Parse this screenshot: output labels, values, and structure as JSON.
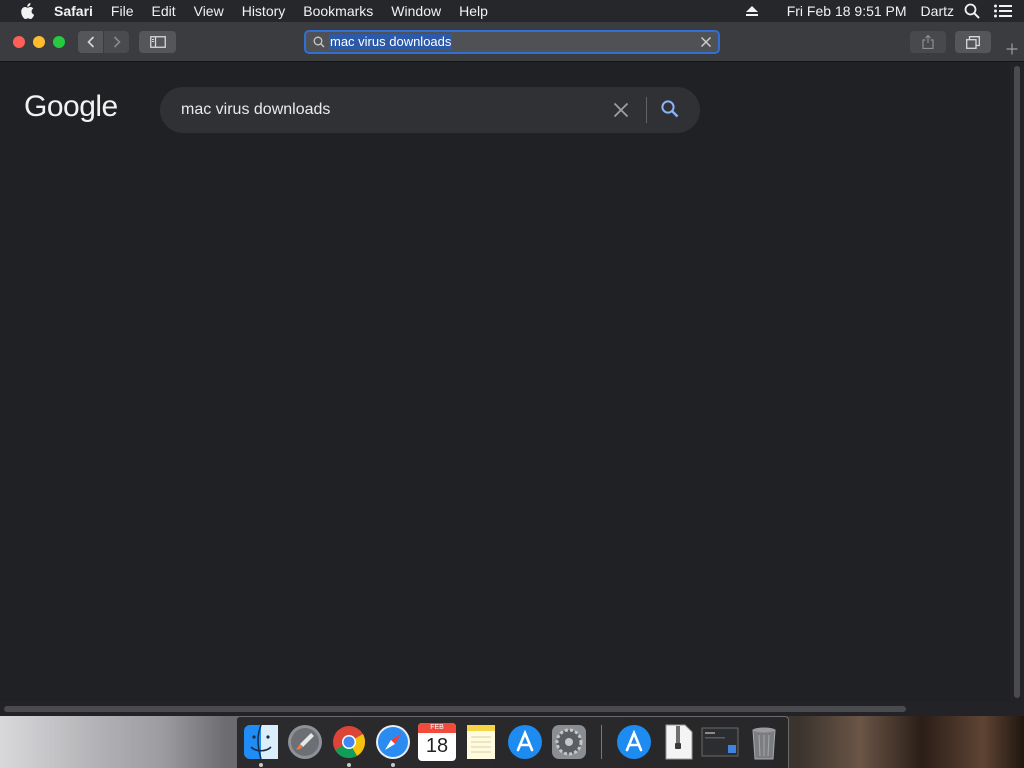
{
  "menubar": {
    "app_name": "Safari",
    "items": [
      "File",
      "Edit",
      "View",
      "History",
      "Bookmarks",
      "Window",
      "Help"
    ],
    "datetime": "Fri Feb 18  9:51 PM",
    "user": "Dartz"
  },
  "toolbar": {
    "address_text": "mac virus downloads"
  },
  "page": {
    "logo": "Google",
    "query": "mac virus downloads"
  },
  "dock": {
    "calendar_month": "FEB",
    "calendar_day": "18"
  },
  "colors": {
    "page_bg": "#202124",
    "searchbox_bg": "#303134",
    "selection_blue": "#2f6fd6",
    "search_icon_blue": "#8ab4f8"
  }
}
